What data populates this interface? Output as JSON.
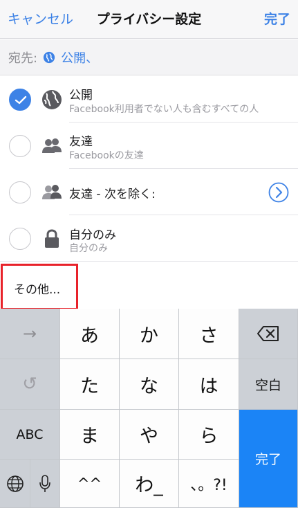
{
  "header": {
    "cancel": "キャンセル",
    "title": "プライバシー設定",
    "done": "完了"
  },
  "to_row": {
    "label": "宛先:",
    "value": "公開、",
    "icon": "globe-icon"
  },
  "options": [
    {
      "label": "公開",
      "sub": "Facebook利用者でない人も含むすべての人",
      "icon": "globe-icon",
      "checked": true
    },
    {
      "label": "友達",
      "sub": "Facebookの友達",
      "icon": "friends-icon",
      "checked": false
    },
    {
      "label": "友達 - 次を除く:",
      "sub": "",
      "icon": "friends-except-icon",
      "checked": false
    },
    {
      "label": "自分のみ",
      "sub": "自分のみ",
      "icon": "lock-icon",
      "checked": false
    }
  ],
  "other": {
    "label": "その他..."
  },
  "keyboard": {
    "rows": [
      [
        "→",
        "あ",
        "か",
        "さ"
      ],
      [
        "↺",
        "た",
        "な",
        "は",
        "空白"
      ],
      [
        "ABC",
        "ま",
        "や",
        "ら"
      ],
      [
        "",
        "",
        "^^",
        "わ_",
        "、。?!"
      ]
    ],
    "delete_icon": "backspace-icon",
    "done": "完了",
    "space": "空白",
    "globe": "globe-icon",
    "mic": "mic-icon"
  },
  "colors": {
    "accent": "#3d82e6",
    "highlight": "#e8222a",
    "keyboard_blue": "#1b84f6"
  }
}
